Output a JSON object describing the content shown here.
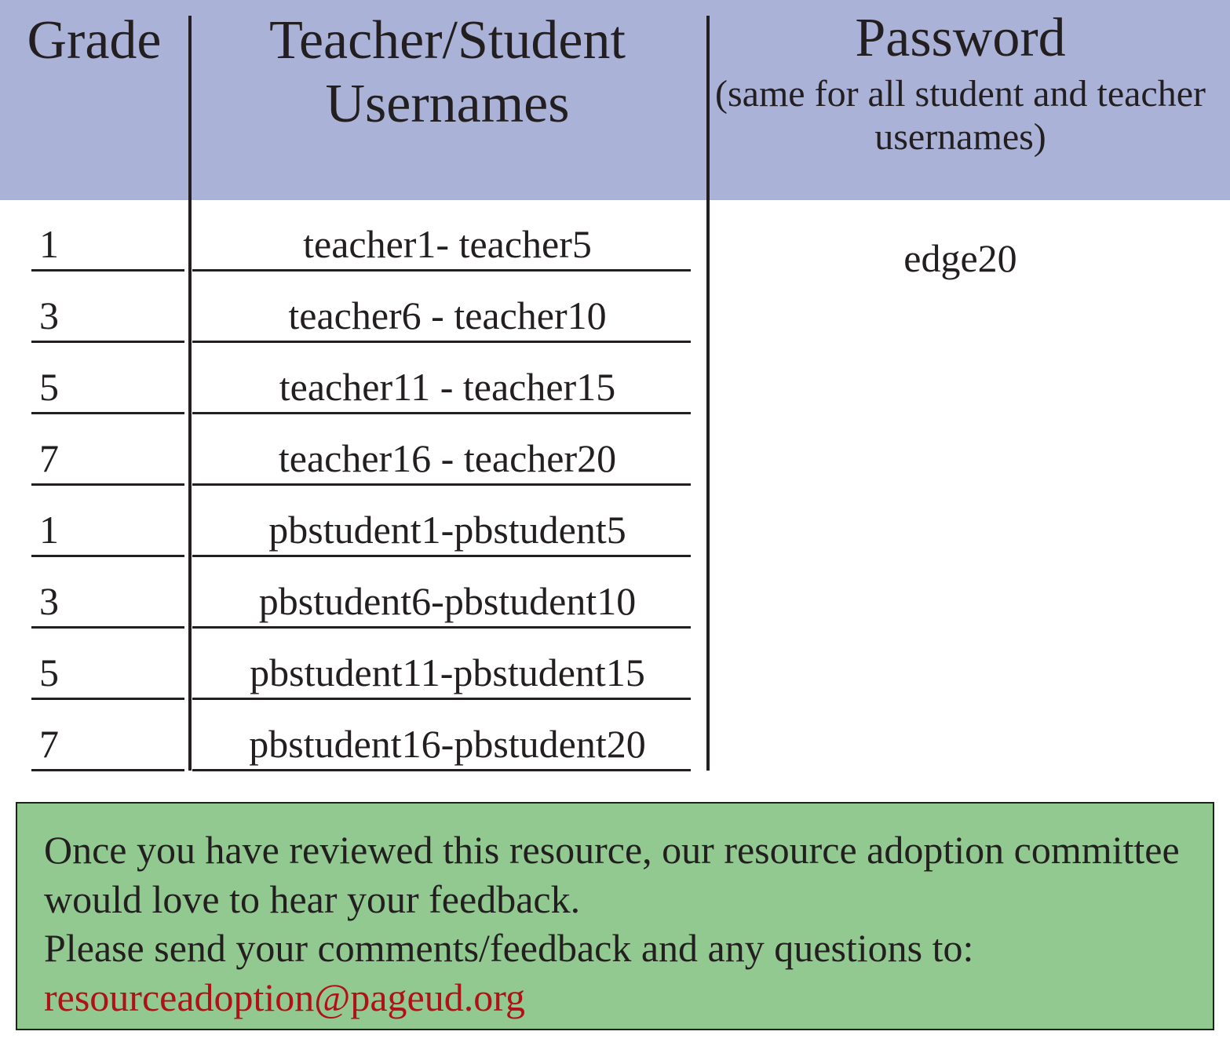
{
  "header": {
    "grade_label": "Grade",
    "usernames_label": "Teacher/Student\nUsernames",
    "password_title": "Password",
    "password_subtitle": "(same for all student and teacher usernames)"
  },
  "password_value": "edge20",
  "rows": [
    {
      "grade": "1",
      "usernames": "teacher1- teacher5"
    },
    {
      "grade": "3",
      "usernames": "teacher6 - teacher10"
    },
    {
      "grade": "5",
      "usernames": "teacher11 - teacher15"
    },
    {
      "grade": "7",
      "usernames": "teacher16 - teacher20"
    },
    {
      "grade": "1",
      "usernames": "pbstudent1-pbstudent5"
    },
    {
      "grade": "3",
      "usernames": "pbstudent6-pbstudent10"
    },
    {
      "grade": "5",
      "usernames": "pbstudent11-pbstudent15"
    },
    {
      "grade": "7",
      "usernames": "pbstudent16-pbstudent20"
    }
  ],
  "footer": {
    "line1": "Once you have reviewed this resource, our resource adoption committee would love to hear your feedback.",
    "line2": "Please send your comments/feedback and any questions to:",
    "email": "resourceadoption@pageud.org"
  }
}
